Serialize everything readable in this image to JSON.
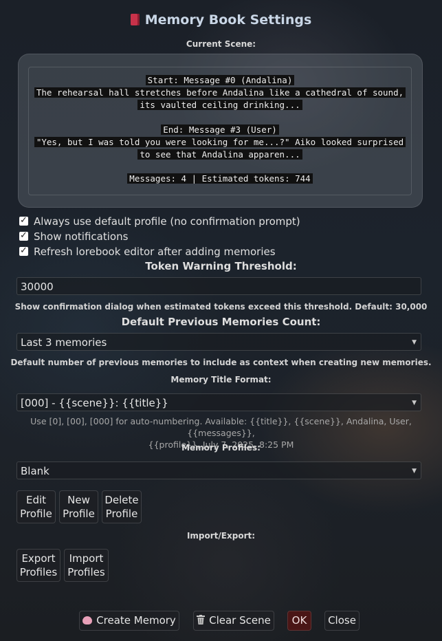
{
  "dialog": {
    "title": "Memory Book Settings",
    "title_icon": "book-icon"
  },
  "scene": {
    "label": "Current Scene:",
    "start_header": "Start: Message #0 (Andalina)",
    "start_line1": "The rehearsal hall stretches before Andalina like a cathedral of sound,",
    "start_line2": "its vaulted ceiling drinking...",
    "end_header": "End: Message #3 (User)",
    "end_line1": "\"Yes, but I was told you were looking for me...?\" Aiko looked surprised",
    "end_line2": "to see that Andalina apparen...",
    "stats": "Messages: 4 | Estimated tokens: 744"
  },
  "options": [
    {
      "label": "Always use default profile (no confirmation prompt)",
      "checked": true
    },
    {
      "label": "Show notifications",
      "checked": true
    },
    {
      "label": "Refresh lorebook editor after adding memories",
      "checked": true
    }
  ],
  "token_warning": {
    "label": "Token Warning Threshold:",
    "value": "30000",
    "hint": "Show confirmation dialog when estimated tokens exceed this threshold. Default: 30,000"
  },
  "prev_memories": {
    "label": "Default Previous Memories Count:",
    "selected": "Last 3 memories",
    "hint": "Default number of previous memories to include as context when creating new memories."
  },
  "title_format": {
    "label": "Memory Title Format:",
    "selected": "[000] - {{scene}}: {{title}}",
    "hint_line1": "Use [0], [00], [000] for auto-numbering. Available: {{title}}, {{scene}}, Andalina, User, {{messages}},",
    "hint_line2": "{{profile}}, July 7, 2025, 8:25 PM"
  },
  "profiles": {
    "label": "Memory Profiles:",
    "selected": "Blank",
    "edit": [
      "Edit",
      "Profile"
    ],
    "new": [
      "New",
      "Profile"
    ],
    "delete": [
      "Delete",
      "Profile"
    ]
  },
  "import_export": {
    "label": "Import/Export:",
    "export": [
      "Export",
      "Profiles"
    ],
    "import": [
      "Import",
      "Profiles"
    ]
  },
  "footer": {
    "create": "Create Memory",
    "create_icon": "brain-icon",
    "clear": "Clear Scene",
    "clear_icon": "trash-icon",
    "ok": "OK",
    "close": "Close"
  }
}
